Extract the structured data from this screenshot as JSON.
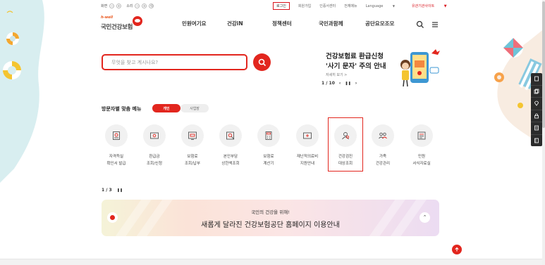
{
  "utility": {
    "text_size": {
      "label": "화면",
      "minus": "−",
      "plus": "+"
    },
    "zoom": {
      "label": "소리",
      "minus": "−",
      "plus": "+",
      "reset": "⟲"
    },
    "links": {
      "login": "로그인",
      "join": "회원가입",
      "cert": "인증서센터",
      "sitemap": "전체메뉴",
      "language": "Language",
      "partner": "유관기관사이트"
    }
  },
  "logo": {
    "tagline": "h-well",
    "name": "국민건강보험"
  },
  "nav": {
    "items": [
      "민원여기요",
      "건강iN",
      "정책센터",
      "국민과함께",
      "공단요모조모"
    ]
  },
  "search": {
    "placeholder": "무엇을 찾고 계시나요?"
  },
  "notice": {
    "line1": "건강보험료 환급신청",
    "line2": "'사기 문자' 주의 안내",
    "more": "자세히 보기 >",
    "pager": "1 / 10",
    "prev": "‹",
    "pause": "❚❚",
    "next": "›"
  },
  "visitor_menu": {
    "title": "방문자별 맞춤 메뉴",
    "tabs": {
      "personal": "개인",
      "business": "사업장"
    },
    "items": [
      {
        "label": "자격득실\n확인서 발급",
        "icon": "certificate-icon"
      },
      {
        "label": "환급금\n조회/신청",
        "icon": "refund-icon"
      },
      {
        "label": "보험료\n조회/납부",
        "icon": "payment-icon"
      },
      {
        "label": "본인부담\n상한액조회",
        "icon": "search-doc-icon"
      },
      {
        "label": "보험료\n계산기",
        "icon": "calculator-icon"
      },
      {
        "label": "재난적의료비\n지원안내",
        "icon": "medical-support-icon"
      },
      {
        "label": "건강검진\n대상조회",
        "icon": "checkup-icon"
      },
      {
        "label": "가족\n건강관리",
        "icon": "family-icon"
      },
      {
        "label": "민원\n서식자료실",
        "icon": "forms-icon"
      }
    ],
    "pager": "1 / 3",
    "pause": "❚❚"
  },
  "banner": {
    "sub": "국민의 건강을 위해!",
    "main": "새롭게 달라진 건강보험공단 홈페이지 이용안내",
    "up": "⌃"
  },
  "colors": {
    "accent": "#e2261e"
  }
}
